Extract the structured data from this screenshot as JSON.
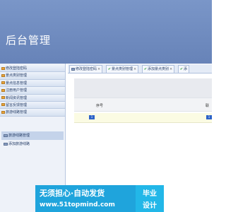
{
  "header": {
    "title": "后台管理"
  },
  "sidebar": {
    "menu": [
      {
        "label": "修改登陆密码"
      },
      {
        "label": "景点类别管理"
      },
      {
        "label": "景点信息管理"
      },
      {
        "label": "注册用户管理"
      },
      {
        "label": "新闻资讯管理"
      },
      {
        "label": "留言反馈管理"
      },
      {
        "label": "旅游线路管理"
      }
    ],
    "submenu": [
      {
        "label": "旅游线路管理"
      },
      {
        "label": "添加旅游线路"
      }
    ]
  },
  "tabs": [
    {
      "label": "修改登陆密码",
      "close": "×"
    },
    {
      "label": "景点类别管理",
      "close": "×"
    },
    {
      "label": "添加景点类别",
      "close": "×"
    },
    {
      "label": "添",
      "close": ""
    }
  ],
  "grid": {
    "columns": [
      "序号",
      "联"
    ],
    "row": {
      "c1": "1",
      "c2": "1"
    }
  },
  "watermark": {
    "line1": "无须担心·自动发货",
    "line2": "www.51topmind.com",
    "badge1": "毕业",
    "badge2": "设计"
  },
  "colors": {
    "header": "#6f8bc0",
    "accent": "#1fa4dc"
  }
}
